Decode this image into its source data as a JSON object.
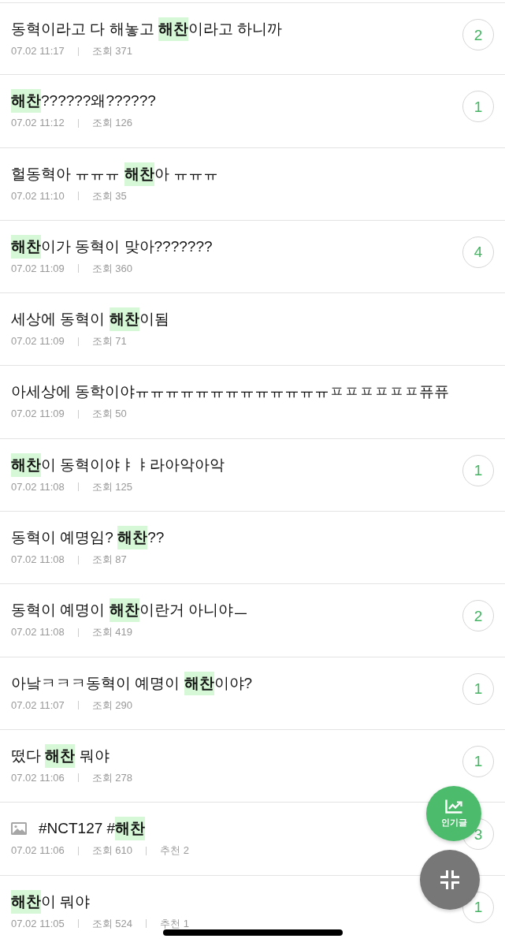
{
  "posts": [
    {
      "title": "동혁이라고 다 해놓고 **해찬**이라고 하니까",
      "has_image": false,
      "date": "07.02 11:17",
      "views": "조회 371",
      "comments": "2"
    },
    {
      "title": "**해찬**??????왜??????",
      "has_image": false,
      "date": "07.02 11:12",
      "views": "조회 126",
      "comments": "1"
    },
    {
      "title": "헐동혁아 ㅠㅠㅠ **해찬**아 ㅠㅠㅠ",
      "has_image": false,
      "date": "07.02 11:10",
      "views": "조회 35"
    },
    {
      "title": "**해찬**이가 동혁이 맞아???????",
      "has_image": false,
      "date": "07.02 11:09",
      "views": "조회 360",
      "comments": "4"
    },
    {
      "title": "세상에 동혁이 **해찬**이됨",
      "has_image": false,
      "date": "07.02 11:09",
      "views": "조회 71"
    },
    {
      "title": "아세상에 동학이야ㅠㅠㅠㅠㅠㅠㅠㅠㅠㅠㅠㅠㅠㅍㅍㅍㅍㅍㅍ퓨퓨",
      "has_image": false,
      "date": "07.02 11:09",
      "views": "조회 50"
    },
    {
      "title": "**해찬**이 동혁이야ㅑㅑ라아악아악",
      "has_image": false,
      "date": "07.02 11:08",
      "views": "조회 125",
      "comments": "1"
    },
    {
      "title": "동혁이 예명임? **해찬**??",
      "has_image": false,
      "date": "07.02 11:08",
      "views": "조회 87"
    },
    {
      "title": "동혁이 예명이 **해찬**이란거 아니야ㅡ",
      "has_image": false,
      "date": "07.02 11:08",
      "views": "조회 419",
      "comments": "2"
    },
    {
      "title": "아낰ㅋㅋㅋ동혁이 예명이 **해찬**이야?",
      "has_image": false,
      "date": "07.02 11:07",
      "views": "조회 290",
      "comments": "1"
    },
    {
      "title": "떴다 **해찬** 뭐야",
      "has_image": false,
      "date": "07.02 11:06",
      "views": "조회 278",
      "comments": "1"
    },
    {
      "title": "#NCT127 #**해찬**",
      "has_image": true,
      "date": "07.02 11:06",
      "views": "조회 610",
      "likes": "추천 2",
      "comments": "3"
    },
    {
      "title": "**해찬**이 뭐야",
      "has_image": false,
      "date": "07.02 11:05",
      "views": "조회 524",
      "likes": "추천 1",
      "comments": "1"
    }
  ],
  "floating_buttons": [
    {
      "kind": "popular",
      "label": "인기글"
    },
    {
      "kind": "collapse"
    }
  ]
}
